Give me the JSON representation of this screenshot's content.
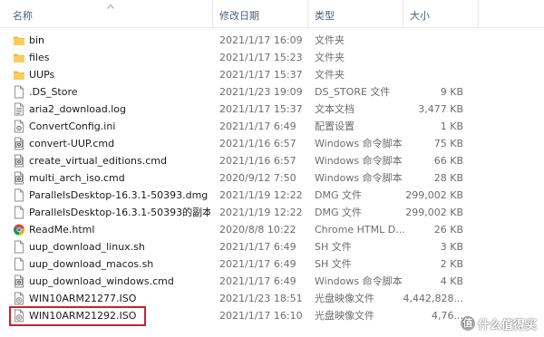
{
  "columns": {
    "name": "名称",
    "date": "修改日期",
    "type": "类型",
    "size": "大小"
  },
  "rows": [
    {
      "name": "bin",
      "date": "2021/1/17 16:09",
      "type": "文件夹",
      "size": "",
      "icon": "folder-icon"
    },
    {
      "name": "files",
      "date": "2021/1/17 15:23",
      "type": "文件夹",
      "size": "",
      "icon": "folder-icon"
    },
    {
      "name": "UUPs",
      "date": "2021/1/17 15:37",
      "type": "文件夹",
      "size": "",
      "icon": "folder-icon"
    },
    {
      "name": ".DS_Store",
      "date": "2021/1/23 19:09",
      "type": "DS_STORE 文件",
      "size": "9 KB",
      "icon": "blank-file-icon"
    },
    {
      "name": "aria2_download.log",
      "date": "2021/1/17 15:37",
      "type": "文本文档",
      "size": "3,477 KB",
      "icon": "text-file-icon"
    },
    {
      "name": "ConvertConfig.ini",
      "date": "2021/1/17 6:49",
      "type": "配置设置",
      "size": "1 KB",
      "icon": "config-file-icon"
    },
    {
      "name": "convert-UUP.cmd",
      "date": "2021/1/16 6:57",
      "type": "Windows 命令脚本",
      "size": "75 KB",
      "icon": "script-file-icon"
    },
    {
      "name": "create_virtual_editions.cmd",
      "date": "2021/1/16 6:57",
      "type": "Windows 命令脚本",
      "size": "66 KB",
      "icon": "script-file-icon"
    },
    {
      "name": "multi_arch_iso.cmd",
      "date": "2020/9/12 7:50",
      "type": "Windows 命令脚本",
      "size": "28 KB",
      "icon": "script-file-icon"
    },
    {
      "name": "ParallelsDesktop-16.3.1-50393.dmg",
      "date": "2021/1/19 12:22",
      "type": "DMG 文件",
      "size": "299,002 KB",
      "icon": "blank-file-icon"
    },
    {
      "name": "ParallelsDesktop-16.3.1-50393的副本....",
      "date": "2021/1/19 12:22",
      "type": "DMG 文件",
      "size": "299,002 KB",
      "icon": "blank-file-icon"
    },
    {
      "name": "ReadMe.html",
      "date": "2020/8/8 10:22",
      "type": "Chrome HTML D...",
      "size": "26 KB",
      "icon": "chrome-icon"
    },
    {
      "name": "uup_download_linux.sh",
      "date": "2021/1/17 6:49",
      "type": "SH 文件",
      "size": "3 KB",
      "icon": "blank-file-icon"
    },
    {
      "name": "uup_download_macos.sh",
      "date": "2021/1/17 6:49",
      "type": "SH 文件",
      "size": "2 KB",
      "icon": "blank-file-icon"
    },
    {
      "name": "uup_download_windows.cmd",
      "date": "2021/1/17 6:49",
      "type": "Windows 命令脚本",
      "size": "4 KB",
      "icon": "script-file-icon"
    },
    {
      "name": "WIN10ARM21277.ISO",
      "date": "2021/1/23 18:51",
      "type": "光盘映像文件",
      "size": "4,442,828...",
      "icon": "disc-image-icon"
    },
    {
      "name": "WIN10ARM21292.ISO",
      "date": "2021/1/17 16:10",
      "type": "光盘映像文件",
      "size": "4,76...",
      "icon": "disc-image-icon"
    }
  ],
  "watermark": {
    "badge": "值",
    "text": "什么值得买"
  }
}
